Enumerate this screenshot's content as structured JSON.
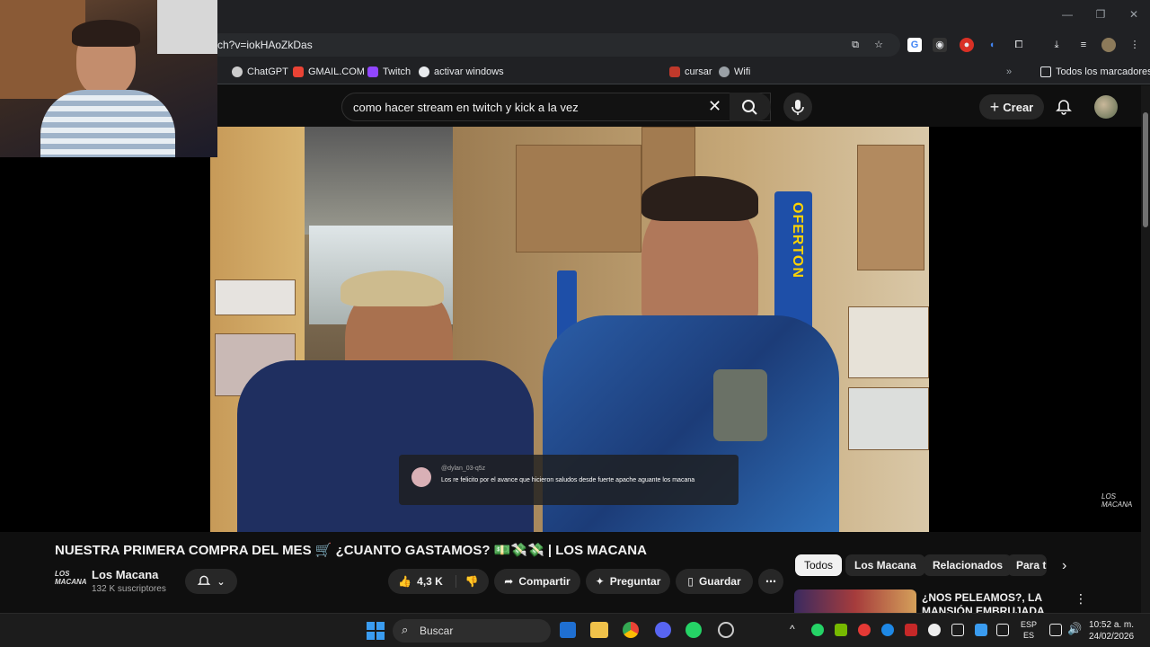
{
  "browser": {
    "url": "ch?v=iokHAoZkDas",
    "bookmarks": [
      {
        "label": "ChatGPT",
        "color": "#cccccc"
      },
      {
        "label": "GMAIL.COM",
        "color": "#ea4335"
      },
      {
        "label": "Twitch",
        "color": "#9146ff"
      },
      {
        "label": "activar windows",
        "color": "#e8eaed"
      },
      {
        "label": "cursar",
        "color": "#c0392b"
      },
      {
        "label": "Wifi",
        "color": "#9aa0a6"
      }
    ],
    "all_bookmarks_label": "Todos los marcadores"
  },
  "youtube": {
    "search_query": "como hacer stream en twitch y kick a la vez",
    "create_label": "Crear"
  },
  "video": {
    "overlay_comment": {
      "user": "@dylan_03-q5z",
      "text": "Los re felicito por el avance que hicieron saludos desde fuerte apache aguante los macana"
    },
    "watermark": "LOS MACANA",
    "shelf_sign": "OFERTON",
    "title": "NUESTRA PRIMERA COMPRA DEL MES 🛒 ¿CUANTO GASTAMOS? 💵💸💸 | LOS MACANA"
  },
  "channel": {
    "logo_text": "LOS MACANA",
    "name": "Los Macana",
    "subscribers": "132 K suscriptores"
  },
  "actions": {
    "likes": "4,3 K",
    "share": "Compartir",
    "ask": "Preguntar",
    "save": "Guardar"
  },
  "chips": [
    "Todos",
    "Los Macana",
    "Relacionados",
    "Para ti"
  ],
  "related": {
    "title": "¿NOS PELEAMOS?, LA MANSIÓN EMBRUJADA"
  },
  "taskbar": {
    "search_label": "Buscar",
    "lang_top": "ESP",
    "lang_bottom": "ES",
    "time": "10:52 a. m.",
    "date": "24/02/2026"
  }
}
